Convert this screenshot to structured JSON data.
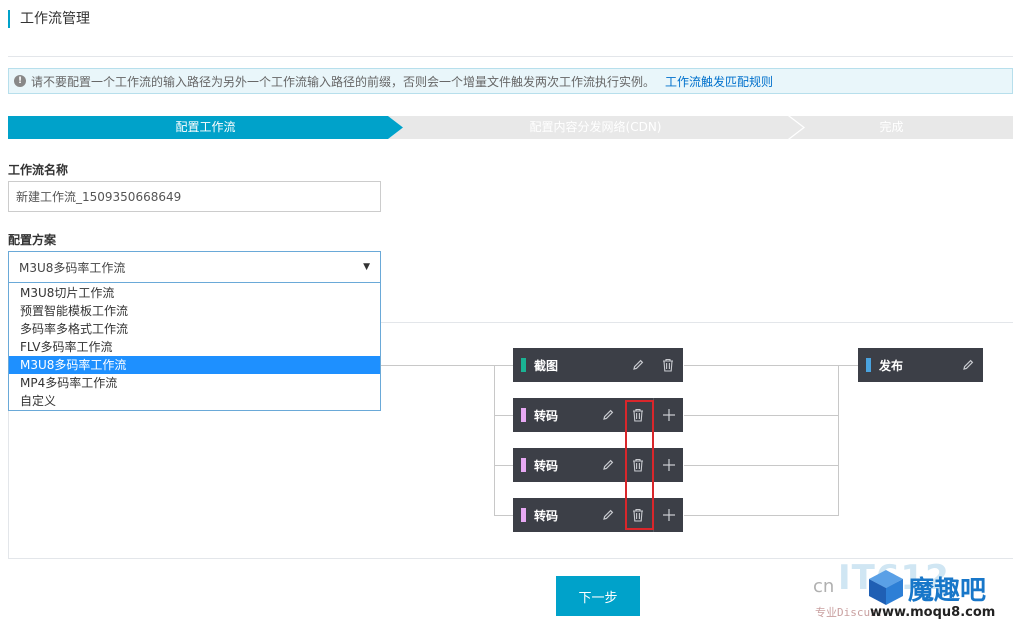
{
  "page": {
    "title": "工作流管理"
  },
  "notice": {
    "icon": "info-icon",
    "text": "请不要配置一个工作流的输入路径为另外一个工作流输入路径的前缀，否则会一个增量文件触发两次工作流执行实例。",
    "link_label": "工作流触发匹配规则"
  },
  "steps": [
    {
      "label": "配置工作流",
      "active": true
    },
    {
      "label": "配置内容分发网络(CDN)",
      "active": false
    },
    {
      "label": "完成",
      "active": false
    }
  ],
  "form": {
    "name_label": "工作流名称",
    "name_value": "新建工作流_1509350668649",
    "scheme_label": "配置方案",
    "scheme_selected": "M3U8多码率工作流",
    "scheme_options": [
      "M3U8切片工作流",
      "预置智能模板工作流",
      "多码率多格式工作流",
      "FLV多码率工作流",
      "M3U8多码率工作流",
      "MP4多码率工作流",
      "自定义"
    ]
  },
  "workflow": {
    "nodes": [
      {
        "label": "截图",
        "color": "#1ab394",
        "actions": [
          "edit-icon",
          "delete-icon"
        ]
      },
      {
        "label": "转码",
        "color": "#e7a9f3",
        "actions": [
          "edit-icon",
          "delete-icon",
          "add-icon"
        ]
      },
      {
        "label": "转码",
        "color": "#e7a9f3",
        "actions": [
          "edit-icon",
          "delete-icon",
          "add-icon"
        ]
      },
      {
        "label": "转码",
        "color": "#e7a9f3",
        "actions": [
          "edit-icon",
          "delete-icon",
          "add-icon"
        ]
      },
      {
        "label": "发布",
        "color": "#4aa3df",
        "actions": [
          "edit-icon"
        ]
      }
    ]
  },
  "footer": {
    "next_label": "下一步"
  },
  "watermark": {
    "prefix": "cn",
    "faded": "IT612",
    "brand": "魔趣吧",
    "tagline": "专业Discuz!",
    "url": "www.moqu8.com"
  },
  "colors": {
    "accent": "#00a2ca",
    "highlight": "#d9262b",
    "node_bg": "#3c3f47"
  }
}
